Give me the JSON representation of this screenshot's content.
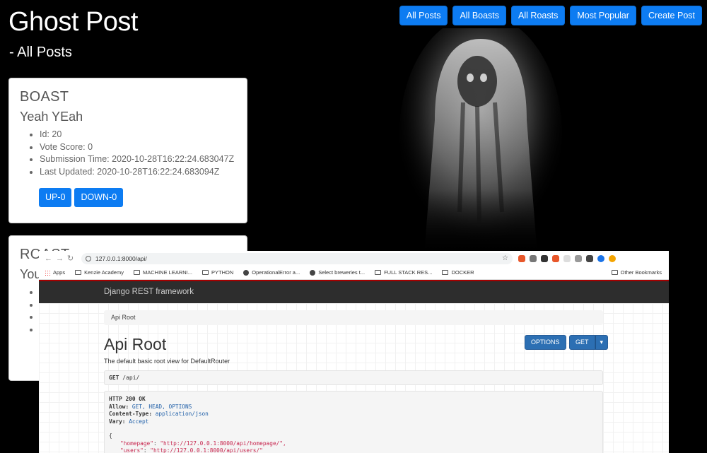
{
  "app": {
    "title": "Ghost Post",
    "subtitle": "- All Posts",
    "nav": [
      "All Posts",
      "All Boasts",
      "All Roasts",
      "Most Popular",
      "Create Post"
    ]
  },
  "posts": [
    {
      "type": "BOAST",
      "text": "Yeah YEah",
      "details": [
        "Id: 20",
        "Vote Score: 0",
        "Submission Time: 2020-10-28T16:22:24.683047Z",
        "Last Updated: 2020-10-28T16:22:24.683094Z"
      ],
      "up_label": "UP-0",
      "down_label": "DOWN-0"
    },
    {
      "type": "ROAST",
      "text": "You"
    }
  ],
  "browser": {
    "url": "127.0.0.1:8000/api/",
    "bookmarks": [
      "Apps",
      "Kenzie Academy",
      "MACHINE LEARNI...",
      "PYTHON",
      "OperationalError a...",
      "Select breweries t...",
      "FULL STACK RES...",
      "DOCKER"
    ],
    "other_bookmarks": "Other Bookmarks",
    "extension_colors": [
      "#e8572a",
      "#777777",
      "#333333",
      "#e8572a",
      "#dddddd",
      "#999999",
      "#444444",
      "#1a73e8",
      "#f4a400"
    ]
  },
  "drf": {
    "brand": "Django REST framework",
    "breadcrumb": "Api Root",
    "title": "Api Root",
    "description": "The default basic root view for DefaultRouter",
    "options_label": "OPTIONS",
    "get_label": "GET",
    "request_method": "GET",
    "request_path": "/api/",
    "response": {
      "status": "HTTP 200 OK",
      "allow_key": "Allow:",
      "allow_value": "GET, HEAD, OPTIONS",
      "content_type_key": "Content-Type:",
      "content_type_value": "application/json",
      "vary_key": "Vary:",
      "vary_value": "Accept",
      "open_brace": "{",
      "entries": [
        {
          "key": "\"homepage\"",
          "value": "\"http://127.0.0.1:8000/api/homepage/\","
        },
        {
          "key": "\"users\"",
          "value": "\"http://127.0.0.1:8000/api/users/\""
        }
      ]
    }
  }
}
